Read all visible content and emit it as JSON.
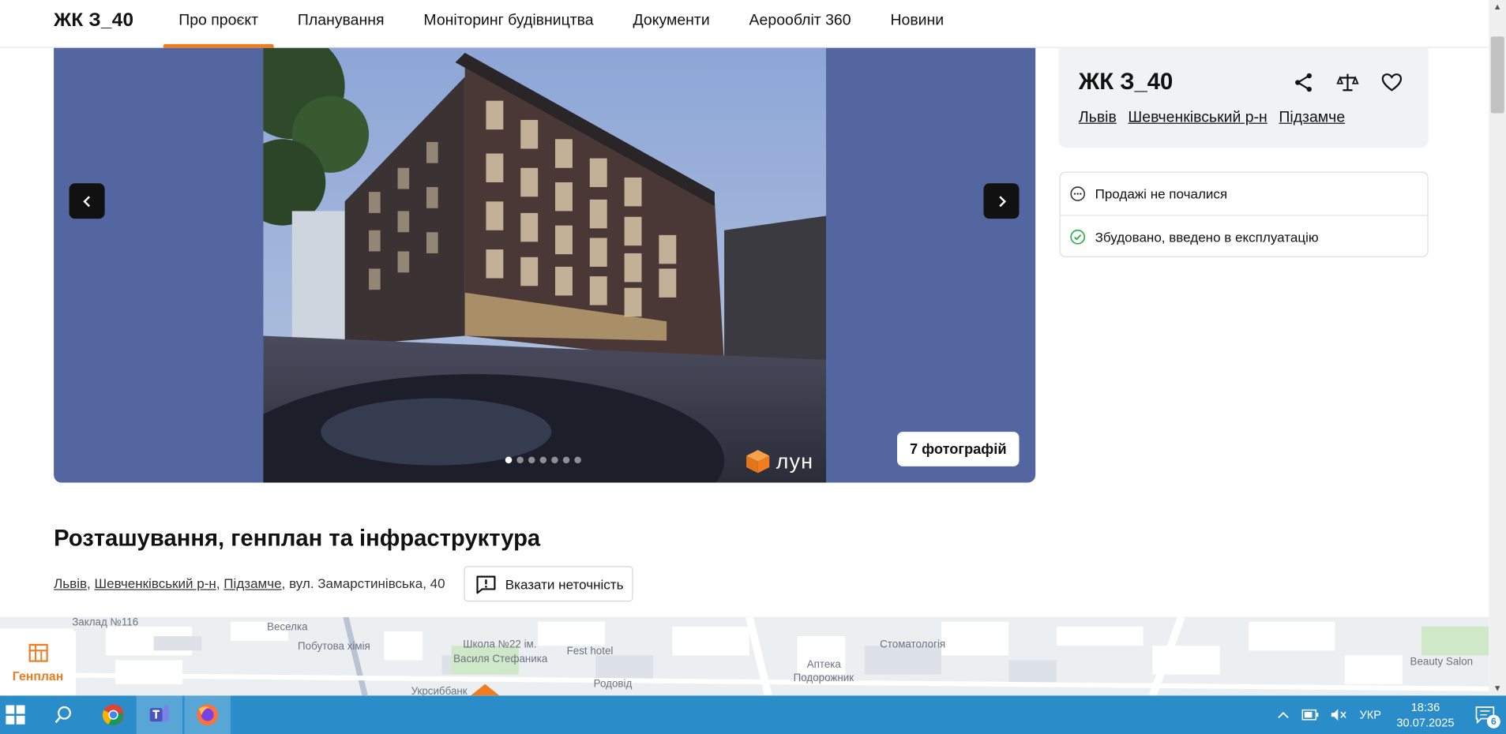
{
  "header": {
    "brand": "ЖК З_40",
    "nav": [
      "Про проєкт",
      "Планування",
      "Моніторинг будівництва",
      "Документи",
      "Аерооблiт 360",
      "Новини"
    ],
    "active_index": 0
  },
  "gallery": {
    "photos_button": "7 фотографій",
    "dots_total": 7,
    "dot_active": 0,
    "watermark": "лун"
  },
  "info_card": {
    "title": "ЖК З_40",
    "links": [
      "Львів",
      "Шевченківський р-н",
      "Підзамче"
    ]
  },
  "status": {
    "sales": "Продажі не почалися",
    "build": "Збудовано, введено в експлуатацію"
  },
  "location": {
    "title": "Розташування, генплан та інфраструктура",
    "city": "Львів",
    "district": "Шевченківський р-н",
    "area": "Підзамче",
    "street": ", вул. Замарстинівська, 40",
    "report_button": "Вказати неточність"
  },
  "map": {
    "genplan_label": "Генплан",
    "labels": [
      "Заклад №116",
      "Веселка",
      "Побутова хімія",
      "Школа №22 ім.",
      "Василя Стефаника",
      "Fest hotel",
      "Родовід",
      "Аптека",
      "Подорожник",
      "Стоматологія",
      "Beauty Salon",
      "Укрсиббанк"
    ]
  },
  "taskbar": {
    "lang": "УКР",
    "time": "18:36",
    "date": "30.07.2025",
    "notifications": "6"
  },
  "colors": {
    "accent": "#f07c1f",
    "gallery_bg": "#5466a0",
    "taskbar": "#2a8dc9",
    "status_ok": "#2fb24c"
  }
}
